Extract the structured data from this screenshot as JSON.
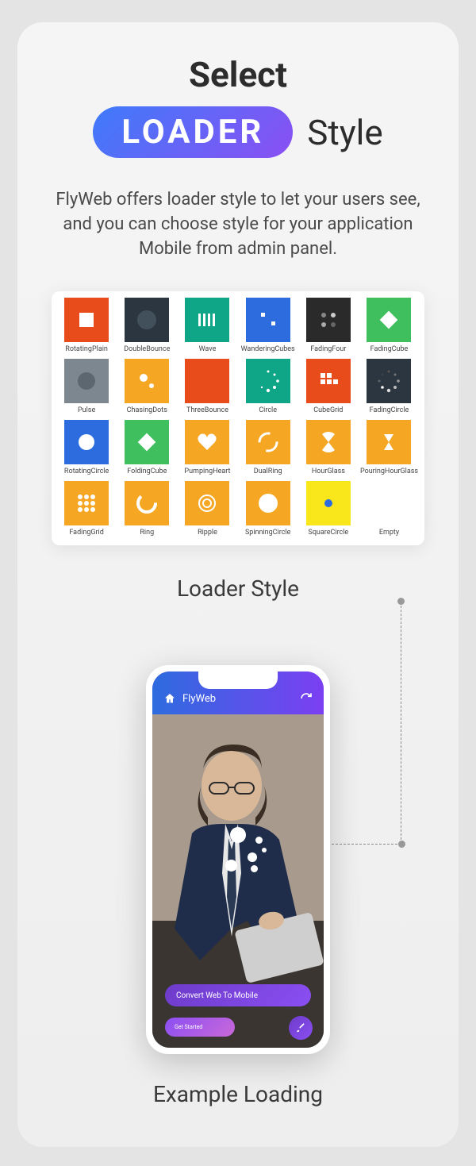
{
  "header": {
    "line1": "Select",
    "pill": "LOADER",
    "line2b": "Style"
  },
  "description": "FlyWeb offers loader style to let your users see, and you can choose style for your application Mobile from admin panel.",
  "loaders": [
    {
      "name": "RotatingPlain",
      "bg": "#e84c1a"
    },
    {
      "name": "DoubleBounce",
      "bg": "#2b3640"
    },
    {
      "name": "Wave",
      "bg": "#0fa688"
    },
    {
      "name": "WanderingCubes",
      "bg": "#2d6cdf"
    },
    {
      "name": "FadingFour",
      "bg": "#2a2a2a"
    },
    {
      "name": "FadingCube",
      "bg": "#3fbf5d"
    },
    {
      "name": "Pulse",
      "bg": "#7d8790"
    },
    {
      "name": "ChasingDots",
      "bg": "#f5a623"
    },
    {
      "name": "ThreeBounce",
      "bg": "#e84c1a"
    },
    {
      "name": "Circle",
      "bg": "#0fa688"
    },
    {
      "name": "CubeGrid",
      "bg": "#e84c1a"
    },
    {
      "name": "FadingCircle",
      "bg": "#2b3640"
    },
    {
      "name": "RotatingCircle",
      "bg": "#2d6cdf"
    },
    {
      "name": "FoldingCube",
      "bg": "#3fbf5d"
    },
    {
      "name": "PumpingHeart",
      "bg": "#f5a623"
    },
    {
      "name": "DualRing",
      "bg": "#f5a623"
    },
    {
      "name": "HourGlass",
      "bg": "#f5a623"
    },
    {
      "name": "PouringHourGlass",
      "bg": "#f5a623"
    },
    {
      "name": "FadingGrid",
      "bg": "#f5a623"
    },
    {
      "name": "Ring",
      "bg": "#f5a623"
    },
    {
      "name": "Ripple",
      "bg": "#f5a623"
    },
    {
      "name": "SpinningCircle",
      "bg": "#f5a623"
    },
    {
      "name": "SquareCircle",
      "bg": "#f9e71c"
    },
    {
      "name": "Empty",
      "bg": "#ffffff"
    }
  ],
  "subtitle_grid": "Loader Style",
  "phone": {
    "app_name": "FlyWeb",
    "banner": "Convert Web To Mobile",
    "cta": "Get Started"
  },
  "subtitle_phone": "Example Loading"
}
